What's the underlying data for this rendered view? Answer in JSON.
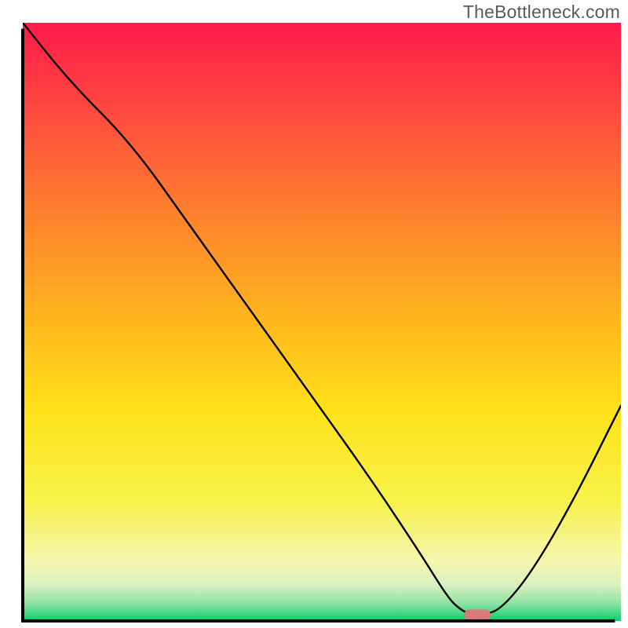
{
  "watermark": "TheBottleneck.com",
  "chart_data": {
    "type": "line",
    "title": "",
    "xlabel": "",
    "ylabel": "",
    "xlim": [
      0,
      100
    ],
    "ylim": [
      0,
      100
    ],
    "gradient_bands": [
      {
        "color": "#ff1a4a",
        "stop": 0.0
      },
      {
        "color": "#ff4a3f",
        "stop": 0.15
      },
      {
        "color": "#ff8a2a",
        "stop": 0.35
      },
      {
        "color": "#ffb71d",
        "stop": 0.5
      },
      {
        "color": "#ffe21a",
        "stop": 0.65
      },
      {
        "color": "#f7f24a",
        "stop": 0.8
      },
      {
        "color": "#f6f6b0",
        "stop": 0.9
      },
      {
        "color": "#d9f0bf",
        "stop": 0.94
      },
      {
        "color": "#8fe3a5",
        "stop": 0.97
      },
      {
        "color": "#35d67f",
        "stop": 0.99
      },
      {
        "color": "#15c96a",
        "stop": 1.0
      }
    ],
    "series": [
      {
        "name": "bottleneck-curve",
        "x": [
          0,
          8,
          18,
          28,
          38,
          48,
          58,
          66,
          71,
          73,
          75,
          77,
          80,
          85,
          92,
          100
        ],
        "y": [
          100,
          90,
          80,
          66,
          52,
          38,
          24,
          12,
          4,
          2,
          1,
          1,
          2,
          8,
          20,
          36
        ]
      }
    ],
    "marker": {
      "name": "optimal-point",
      "x": 76,
      "y": 1,
      "color": "#d97a7a",
      "shape": "pill"
    },
    "axes": {
      "left": {
        "x": 3.5,
        "y0": 3.5,
        "y1": 99.0
      },
      "bottom": {
        "y": 99.0,
        "x0": 3.5,
        "x1": 99.0
      }
    }
  }
}
